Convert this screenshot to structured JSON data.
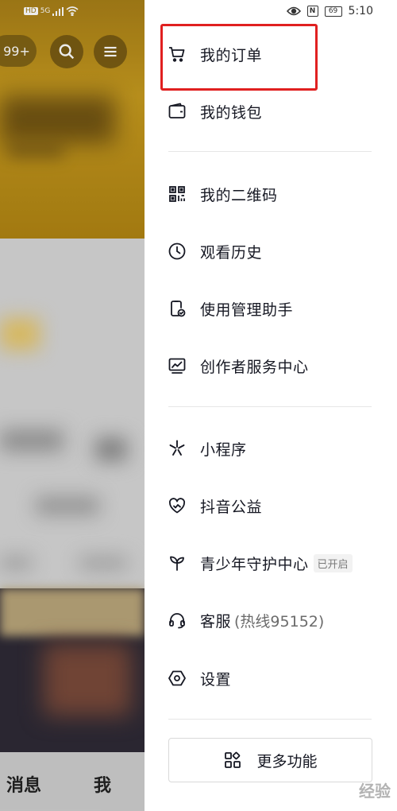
{
  "status_bar": {
    "left_labels": [
      "HD",
      "5G"
    ],
    "time": "5:10",
    "battery": "69"
  },
  "background": {
    "notification_count": "99+",
    "bottom_tabs": [
      "消息",
      "我"
    ]
  },
  "drawer": {
    "items": [
      {
        "label": "我的订单",
        "icon": "cart-icon"
      },
      {
        "label": "我的钱包",
        "icon": "wallet-icon"
      },
      {
        "label": "我的二维码",
        "icon": "qr-code-icon"
      },
      {
        "label": "观看历史",
        "icon": "clock-icon"
      },
      {
        "label": "使用管理助手",
        "icon": "phone-check-icon"
      },
      {
        "label": "创作者服务中心",
        "icon": "monitor-chart-icon"
      },
      {
        "label": "小程序",
        "icon": "asterisk-icon"
      },
      {
        "label": "抖音公益",
        "icon": "heart-icon"
      },
      {
        "label": "青少年守护中心",
        "icon": "sprout-icon",
        "badge": "已开启"
      },
      {
        "label": "客服",
        "sub": "(热线95152)",
        "icon": "headset-icon"
      },
      {
        "label": "设置",
        "icon": "hexagon-settings-icon"
      }
    ],
    "more_button": "更多功能"
  },
  "watermark": "经验"
}
